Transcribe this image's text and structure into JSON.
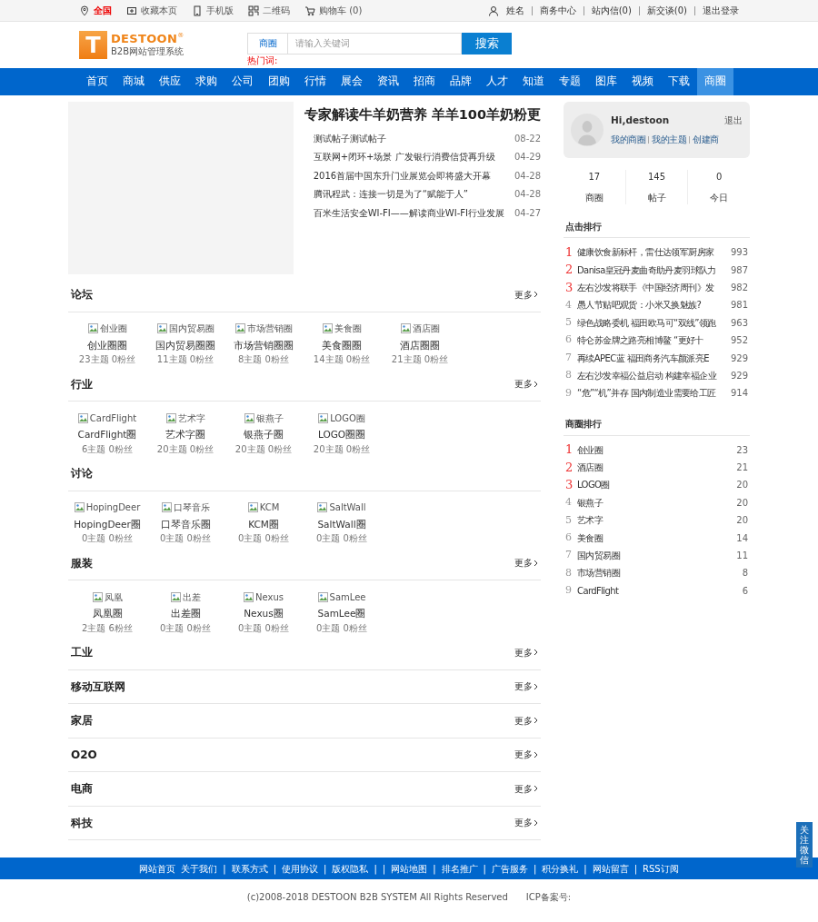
{
  "top_bar": {
    "location": "全国",
    "links": [
      "收藏本页",
      "手机版",
      "二维码",
      "购物车 (0)"
    ],
    "user_links": [
      "姓名",
      "商务中心",
      "站内信(0)",
      "新交谈(0)",
      "退出登录"
    ]
  },
  "header": {
    "logo_name": "DESTOON",
    "logo_letter": "T",
    "logo_mark": "®",
    "logo_sub": "B2B网站管理系统",
    "search_scope": "商圈",
    "search_placeholder": "请输入关键词",
    "search_button": "搜索",
    "hot_words_label": "热门词:"
  },
  "nav": [
    {
      "label": "首页",
      "selected": false
    },
    {
      "label": "商城",
      "selected": false
    },
    {
      "label": "供应",
      "selected": false
    },
    {
      "label": "求购",
      "selected": false
    },
    {
      "label": "公司",
      "selected": false
    },
    {
      "label": "团购",
      "selected": false
    },
    {
      "label": "行情",
      "selected": false
    },
    {
      "label": "展会",
      "selected": false
    },
    {
      "label": "资讯",
      "selected": false
    },
    {
      "label": "招商",
      "selected": false
    },
    {
      "label": "品牌",
      "selected": false
    },
    {
      "label": "人才",
      "selected": false
    },
    {
      "label": "知道",
      "selected": false
    },
    {
      "label": "专题",
      "selected": false
    },
    {
      "label": "图库",
      "selected": false
    },
    {
      "label": "视频",
      "selected": false
    },
    {
      "label": "下载",
      "selected": false
    },
    {
      "label": "商圈",
      "selected": true
    }
  ],
  "headline": {
    "title": "专家解读牛羊奶营养 羊羊100羊奶粉更",
    "news": [
      {
        "title": "测试帖子测试帖子",
        "date": "08-22"
      },
      {
        "title": "互联网+闭环+场景 广发银行消费信贷再升级",
        "date": "04-29"
      },
      {
        "title": "2016首届中国东升门业展览会即将盛大开幕",
        "date": "04-28"
      },
      {
        "title": "腾讯程武：连接一切是为了“赋能于人”",
        "date": "04-28"
      },
      {
        "title": "百米生活安全WI-FI——解读商业WI-FI行业发展",
        "date": "04-27"
      }
    ]
  },
  "sections": [
    {
      "title": "论坛",
      "more": "更多",
      "items": [
        {
          "alt": "创业圈",
          "name": "创业圈圈",
          "stats": "23主题 0粉丝"
        },
        {
          "alt": "国内贸易圈",
          "name": "国内贸易圈圈",
          "stats": "11主题 0粉丝"
        },
        {
          "alt": "市场营销圈",
          "name": "市场营销圈圈",
          "stats": "8主题 0粉丝"
        },
        {
          "alt": "美食圈",
          "name": "美食圈圈",
          "stats": "14主题 0粉丝"
        },
        {
          "alt": "酒店圈",
          "name": "酒店圈圈",
          "stats": "21主题 0粉丝"
        }
      ]
    },
    {
      "title": "行业",
      "more": "更多",
      "items": [
        {
          "alt": "CardFlight",
          "name": "CardFlight圈",
          "stats": "6主题 0粉丝"
        },
        {
          "alt": "艺术字",
          "name": "艺术字圈",
          "stats": "20主题 0粉丝"
        },
        {
          "alt": "银燕子",
          "name": "银燕子圈",
          "stats": "20主题 0粉丝"
        },
        {
          "alt": "LOGO圈",
          "name": "LOGO圈圈",
          "stats": "20主题 0粉丝"
        }
      ]
    },
    {
      "title": "讨论",
      "items": [
        {
          "alt": "HopingDeer",
          "name": "HopingDeer圈",
          "stats": "0主题 0粉丝"
        },
        {
          "alt": "口琴音乐",
          "name": "口琴音乐圈",
          "stats": "0主题 0粉丝"
        },
        {
          "alt": "KCM",
          "name": "KCM圈",
          "stats": "0主题 0粉丝"
        },
        {
          "alt": "SaltWall",
          "name": "SaltWall圈",
          "stats": "0主题 0粉丝"
        }
      ]
    },
    {
      "title": "服装",
      "more": "更多",
      "items": [
        {
          "alt": "凤凰",
          "name": "凤凰圈",
          "stats": "2主题 6粉丝"
        },
        {
          "alt": "出差",
          "name": "出差圈",
          "stats": "0主题 0粉丝"
        },
        {
          "alt": "Nexus",
          "name": "Nexus圈",
          "stats": "0主题 0粉丝"
        },
        {
          "alt": "SamLee",
          "name": "SamLee圈",
          "stats": "0主题 0粉丝"
        }
      ]
    },
    {
      "title": "工业",
      "more": "更多"
    },
    {
      "title": "移动互联网",
      "more": "更多"
    },
    {
      "title": "家居",
      "more": "更多"
    },
    {
      "title": "O2O",
      "more": "更多"
    },
    {
      "title": "电商",
      "more": "更多"
    },
    {
      "title": "科技",
      "more": "更多"
    }
  ],
  "user_card": {
    "greeting": "Hi,destoon",
    "logout": "退出",
    "links": [
      "我的商圈",
      "我的主题",
      "创建商"
    ]
  },
  "stats": [
    {
      "value": "17",
      "label": "商圈"
    },
    {
      "value": "145",
      "label": "帖子"
    },
    {
      "value": "0",
      "label": "今日"
    }
  ],
  "rankings": [
    {
      "title": "点击排行",
      "items": [
        {
          "rank": "1",
          "highlighted": true,
          "title": "健康饮食新标杆，雷仕达领军厨房家",
          "count": "993"
        },
        {
          "rank": "2",
          "highlighted": true,
          "title": "Danisa皇冠丹麦曲奇助丹麦羽球队力",
          "count": "987"
        },
        {
          "rank": "3",
          "highlighted": true,
          "title": "左右沙发将联手《中国经济周刊》发",
          "count": "982"
        },
        {
          "rank": "4",
          "highlighted": false,
          "title": "愚人节贴吧观货：小米又换魅族?",
          "count": "981"
        },
        {
          "rank": "5",
          "highlighted": false,
          "title": "绿色战略委机 福田欧马可“双线”领跑",
          "count": "963"
        },
        {
          "rank": "6",
          "highlighted": false,
          "title": "特仑苏金牌之路亮相博鳌 “更好十",
          "count": "952"
        },
        {
          "rank": "7",
          "highlighted": false,
          "title": "再续APEC蓝 福田商务汽车颜派亮E",
          "count": "929"
        },
        {
          "rank": "8",
          "highlighted": false,
          "title": "左右沙发幸福公益启动 构建幸福企业",
          "count": "929"
        },
        {
          "rank": "9",
          "highlighted": false,
          "title": "“危”“机”并存 国内制造业需要给工匠",
          "count": "914"
        }
      ]
    },
    {
      "title": "商圈排行",
      "items": [
        {
          "rank": "1",
          "highlighted": true,
          "title": "创业圈",
          "count": "23"
        },
        {
          "rank": "2",
          "highlighted": true,
          "title": "酒店圈",
          "count": "21"
        },
        {
          "rank": "3",
          "highlighted": true,
          "title": "LOGO圈",
          "count": "20"
        },
        {
          "rank": "4",
          "highlighted": false,
          "title": "银燕子",
          "count": "20"
        },
        {
          "rank": "5",
          "highlighted": false,
          "title": "艺术字",
          "count": "20"
        },
        {
          "rank": "6",
          "highlighted": false,
          "title": "美食圈",
          "count": "14"
        },
        {
          "rank": "7",
          "highlighted": false,
          "title": "国内贸易圈",
          "count": "11"
        },
        {
          "rank": "8",
          "highlighted": false,
          "title": "市场营销圈",
          "count": "8"
        },
        {
          "rank": "9",
          "highlighted": false,
          "title": "CardFlight",
          "count": "6"
        }
      ]
    }
  ],
  "footer": {
    "links": [
      "网站首页",
      "关于我们",
      "|",
      "联系方式",
      "|",
      "使用协议",
      "|",
      "版权隐私",
      "|",
      "|",
      "网站地图",
      "|",
      "排名推广",
      "|",
      "广告服务",
      "|",
      "积分换礼",
      "|",
      "网站留言",
      "|",
      "RSS订阅"
    ],
    "copyright": "(c)2008-2018 DESTOON B2B SYSTEM All Rights Reserved",
    "icp": "ICP备案号:"
  },
  "float_button": "关注微信"
}
